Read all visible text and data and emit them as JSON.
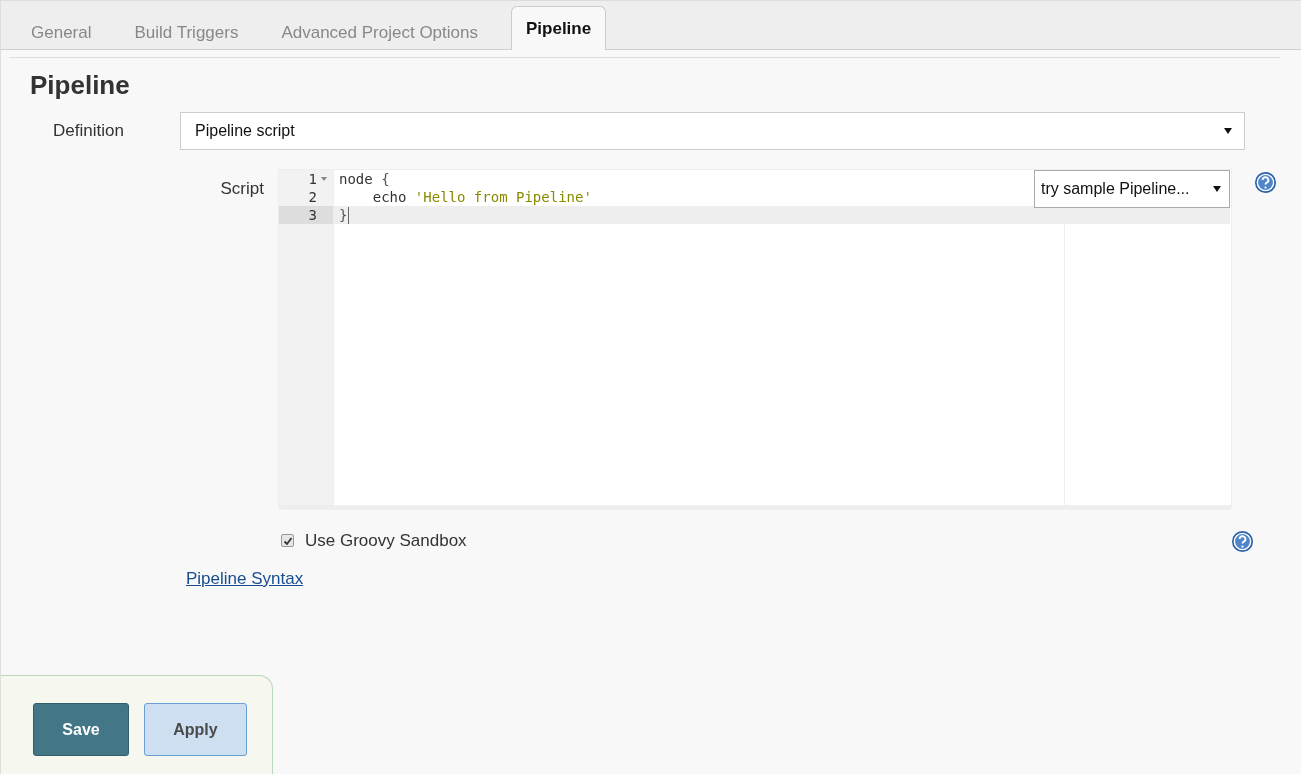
{
  "tabs": [
    {
      "label": "General",
      "selected": false
    },
    {
      "label": "Build Triggers",
      "selected": false
    },
    {
      "label": "Advanced Project Options",
      "selected": false
    },
    {
      "label": "Pipeline",
      "selected": true
    }
  ],
  "section": {
    "title": "Pipeline"
  },
  "definition": {
    "label": "Definition",
    "value": "Pipeline script"
  },
  "script": {
    "label": "Script",
    "sample_dropdown": "try sample Pipeline...",
    "lines": [
      {
        "number": "1",
        "foldable": true,
        "active": false,
        "tokens": [
          {
            "kind": "plain",
            "text": "node "
          },
          {
            "kind": "bracket",
            "text": "{"
          }
        ]
      },
      {
        "number": "2",
        "foldable": false,
        "active": false,
        "tokens": [
          {
            "kind": "plain",
            "text": "    echo "
          },
          {
            "kind": "string",
            "text": "'Hello from Pipeline'"
          }
        ]
      },
      {
        "number": "3",
        "foldable": false,
        "active": true,
        "tokens": [
          {
            "kind": "bracket",
            "text": "}"
          }
        ]
      }
    ]
  },
  "sandbox": {
    "label": "Use Groovy Sandbox",
    "checked": true
  },
  "syntax_link": "Pipeline Syntax",
  "buttons": [
    {
      "label": "Save",
      "kind": "primary"
    },
    {
      "label": "Apply",
      "kind": "secondary"
    }
  ]
}
